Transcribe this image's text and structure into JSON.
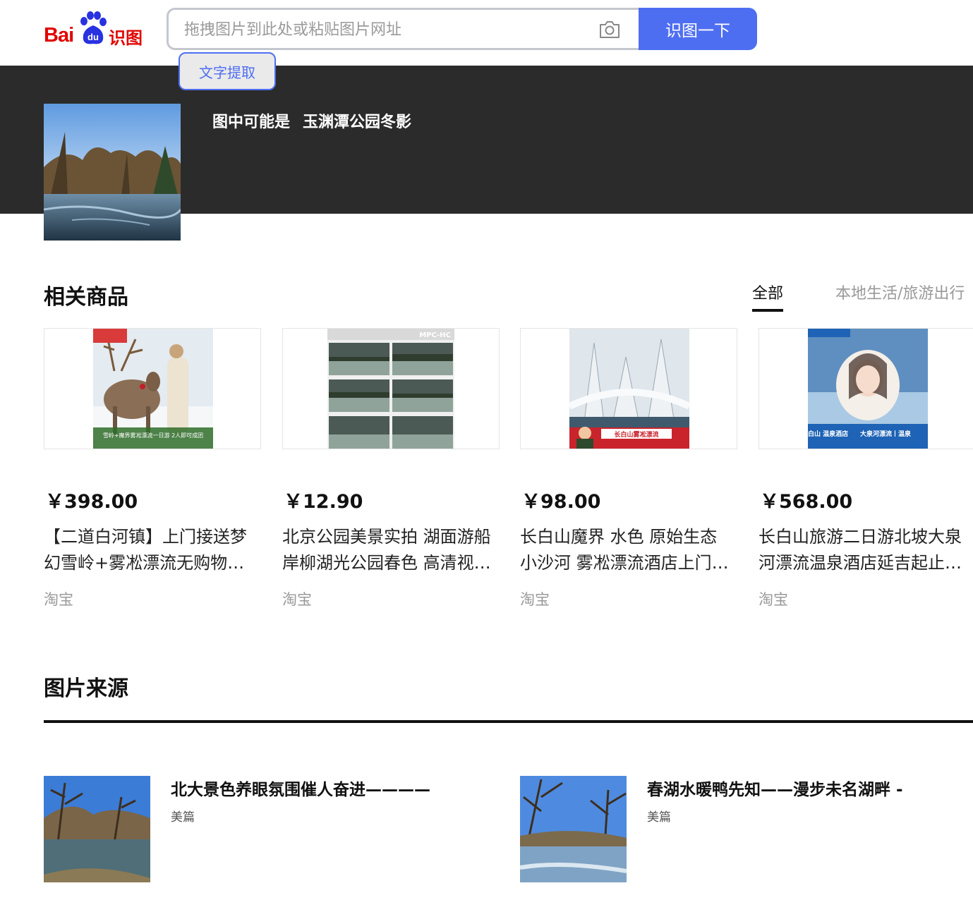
{
  "header": {
    "logo_text_bai": "Bai",
    "logo_text_du": "du",
    "logo_text_product": "识图",
    "search_placeholder": "拖拽图片到此处或粘贴图片网址",
    "search_button": "识图一下",
    "ocr_button": "文字提取",
    "brand_color": "#4e6ef2",
    "logo_color": "#e10601"
  },
  "result": {
    "guess_prefix": "图中可能是",
    "guess_value": "玉渊潭公园冬影"
  },
  "goods": {
    "title": "相关商品",
    "tabs": [
      {
        "label": "全部",
        "active": true
      },
      {
        "label": "本地生活/旅游出行",
        "active": false
      }
    ],
    "items": [
      {
        "price": "￥398.00",
        "title": "【二道白河镇】上门接送梦幻雪岭+雾凇漂流无购物纯玩一日游",
        "shop": "淘宝"
      },
      {
        "price": "￥12.90",
        "title": "北京公园美景实拍 湖面游船岸柳湖光公园春色 高清视频素材",
        "shop": "淘宝"
      },
      {
        "price": "￥98.00",
        "title": "长白山魔界 水色 原始生态 小沙河 雾凇漂流酒店上门接送",
        "shop": "淘宝"
      },
      {
        "price": "￥568.00",
        "title": "长白山旅游二日游北坡大泉河漂流温泉酒店延吉起止纯玩",
        "shop": "淘宝"
      }
    ]
  },
  "sources": {
    "title": "图片来源",
    "items": [
      {
        "title": "北大景色养眼氛围催人奋进————",
        "site": "美篇"
      },
      {
        "title": "春湖水暖鸭先知——漫步未名湖畔 -",
        "site": "美篇"
      }
    ]
  },
  "thumb_overlays": {
    "product1_banner": "雪岭+魔界雾凇漂流一日游  2人即可成团",
    "product2_badge": "MPC-HC",
    "product3_banner": "长白山雾凇漂流",
    "product4_left": "长白山 温泉酒店",
    "product4_right": "大泉河漂流丨温泉"
  }
}
